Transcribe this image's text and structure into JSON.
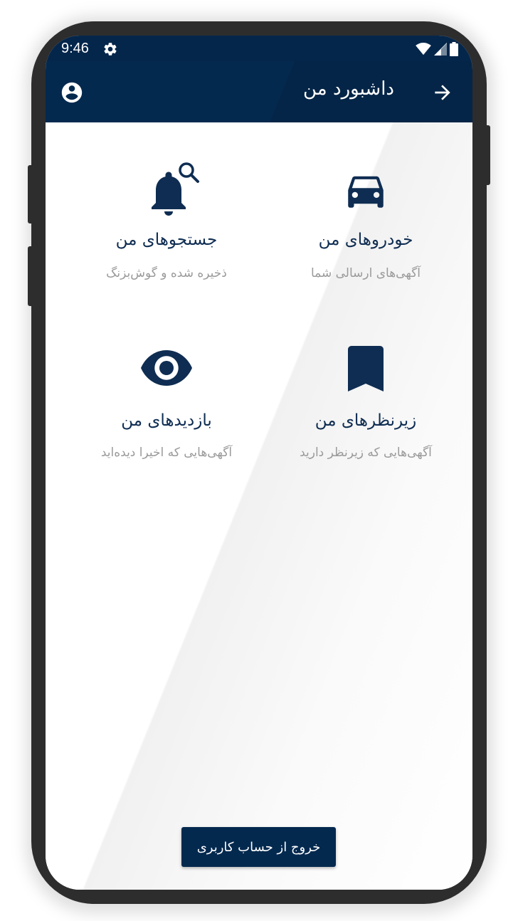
{
  "status_bar": {
    "time": "9:46"
  },
  "header": {
    "title": "داشبورد من"
  },
  "dashboard": {
    "items": [
      {
        "title": "خودروهای من",
        "subtitle": "آگهی‌های ارسالی شما",
        "icon": "car-icon"
      },
      {
        "title": "جستجوهای من",
        "subtitle": "ذخیره شده و گوش‌بزنگ",
        "icon": "bell-search-icon"
      },
      {
        "title": "زیرنظرهای من",
        "subtitle": "آگهی‌هایی که زیرنظر دارید",
        "icon": "bookmark-icon"
      },
      {
        "title": "بازدیدهای من",
        "subtitle": "آگهی‌هایی که اخیرا دیده‌اید",
        "icon": "eye-icon"
      }
    ]
  },
  "footer": {
    "logout_label": "خروج از حساب کاربری"
  },
  "colors": {
    "primary": "#04294f",
    "icon": "#0f2d52",
    "subtitle": "#9a9a9a"
  }
}
